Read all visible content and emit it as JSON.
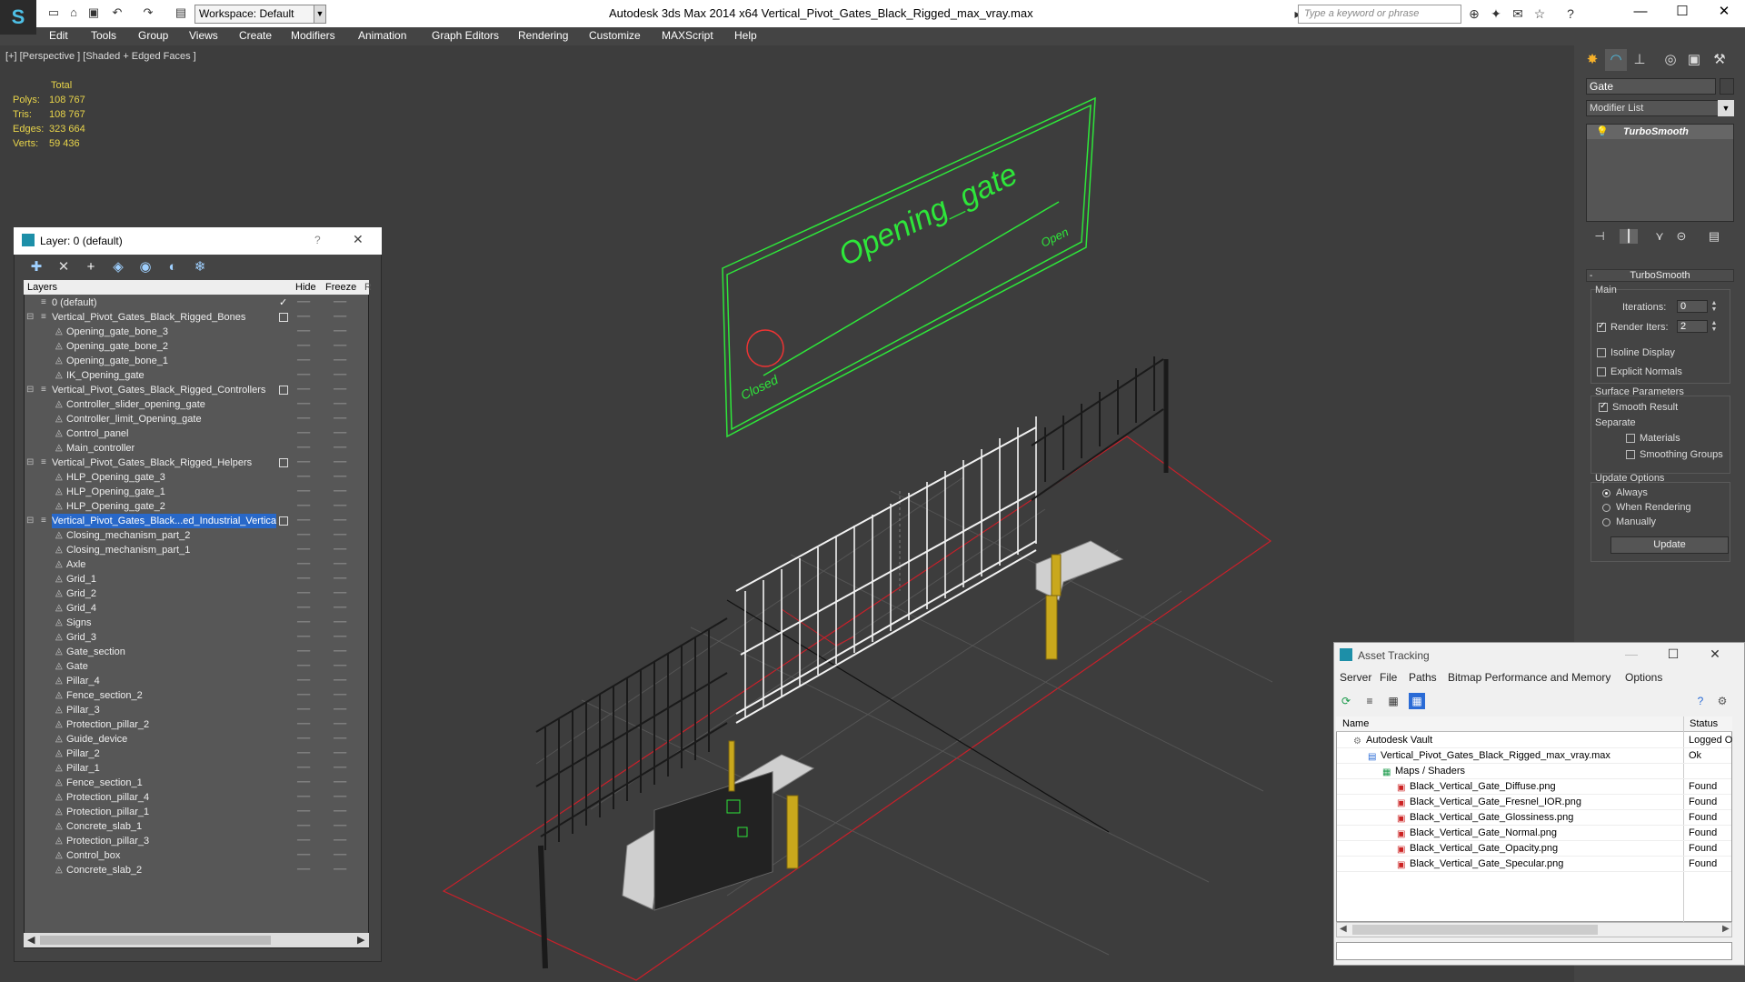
{
  "titlebar": {
    "workspace": "Workspace: Default",
    "title": "Autodesk 3ds Max  2014 x64        Vertical_Pivot_Gates_Black_Rigged_max_vray.max",
    "search_placeholder": "Type a keyword or phrase"
  },
  "menu": [
    "Edit",
    "Tools",
    "Group",
    "Views",
    "Create",
    "Modifiers",
    "Animation",
    "Graph Editors",
    "Rendering",
    "Customize",
    "MAXScript",
    "Help"
  ],
  "viewport": {
    "label": "[+] [Perspective ] [Shaded + Edged Faces ]",
    "stats_header": "Total",
    "stats": [
      {
        "label": "Polys:",
        "value": "108 767"
      },
      {
        "label": "Tris:",
        "value": "108 767"
      },
      {
        "label": "Edges:",
        "value": "323 664"
      },
      {
        "label": "Verts:",
        "value": "59 436"
      }
    ],
    "sign_title": "Opening_gate",
    "sign_open": "Open",
    "sign_closed": "Closed"
  },
  "layer_window": {
    "title": "Layer: 0 (default)",
    "help": "?",
    "col_layers": "Layers",
    "col_hide": "Hide",
    "col_freeze": "Freeze",
    "col_extra": "R",
    "rows": [
      {
        "name": "0 (default)",
        "level": 0,
        "type": "layer",
        "current": true
      },
      {
        "name": "Vertical_Pivot_Gates_Black_Rigged_Bones",
        "level": 0,
        "type": "layer"
      },
      {
        "name": "Opening_gate_bone_3",
        "level": 1,
        "type": "obj"
      },
      {
        "name": "Opening_gate_bone_2",
        "level": 1,
        "type": "obj"
      },
      {
        "name": "Opening_gate_bone_1",
        "level": 1,
        "type": "obj"
      },
      {
        "name": "IK_Opening_gate",
        "level": 1,
        "type": "obj"
      },
      {
        "name": "Vertical_Pivot_Gates_Black_Rigged_Controllers",
        "level": 0,
        "type": "layer"
      },
      {
        "name": "Controller_slider_opening_gate",
        "level": 1,
        "type": "obj"
      },
      {
        "name": "Controller_limit_Opening_gate",
        "level": 1,
        "type": "obj"
      },
      {
        "name": "Control_panel",
        "level": 1,
        "type": "obj"
      },
      {
        "name": "Main_controller",
        "level": 1,
        "type": "obj"
      },
      {
        "name": "Vertical_Pivot_Gates_Black_Rigged_Helpers",
        "level": 0,
        "type": "layer"
      },
      {
        "name": "HLP_Opening_gate_3",
        "level": 1,
        "type": "obj"
      },
      {
        "name": "HLP_Opening_gate_1",
        "level": 1,
        "type": "obj"
      },
      {
        "name": "HLP_Opening_gate_2",
        "level": 1,
        "type": "obj"
      },
      {
        "name": "Vertical_Pivot_Gates_Black...ed_Industrial_Vertica",
        "level": 0,
        "type": "layer",
        "selected": true
      },
      {
        "name": "Closing_mechanism_part_2",
        "level": 1,
        "type": "obj"
      },
      {
        "name": "Closing_mechanism_part_1",
        "level": 1,
        "type": "obj"
      },
      {
        "name": "Axle",
        "level": 1,
        "type": "obj"
      },
      {
        "name": "Grid_1",
        "level": 1,
        "type": "obj"
      },
      {
        "name": "Grid_2",
        "level": 1,
        "type": "obj"
      },
      {
        "name": "Grid_4",
        "level": 1,
        "type": "obj"
      },
      {
        "name": "Signs",
        "level": 1,
        "type": "obj"
      },
      {
        "name": "Grid_3",
        "level": 1,
        "type": "obj"
      },
      {
        "name": "Gate_section",
        "level": 1,
        "type": "obj"
      },
      {
        "name": "Gate",
        "level": 1,
        "type": "obj"
      },
      {
        "name": "Pillar_4",
        "level": 1,
        "type": "obj"
      },
      {
        "name": "Fence_section_2",
        "level": 1,
        "type": "obj"
      },
      {
        "name": "Pillar_3",
        "level": 1,
        "type": "obj"
      },
      {
        "name": "Protection_pillar_2",
        "level": 1,
        "type": "obj"
      },
      {
        "name": "Guide_device",
        "level": 1,
        "type": "obj"
      },
      {
        "name": "Pillar_2",
        "level": 1,
        "type": "obj"
      },
      {
        "name": "Pillar_1",
        "level": 1,
        "type": "obj"
      },
      {
        "name": "Fence_section_1",
        "level": 1,
        "type": "obj"
      },
      {
        "name": "Protection_pillar_4",
        "level": 1,
        "type": "obj"
      },
      {
        "name": "Protection_pillar_1",
        "level": 1,
        "type": "obj"
      },
      {
        "name": "Concrete_slab_1",
        "level": 1,
        "type": "obj"
      },
      {
        "name": "Protection_pillar_3",
        "level": 1,
        "type": "obj"
      },
      {
        "name": "Control_box",
        "level": 1,
        "type": "obj"
      },
      {
        "name": "Concrete_slab_2",
        "level": 1,
        "type": "obj"
      }
    ]
  },
  "command_panel": {
    "object_name": "Gate",
    "modifier_list": "Modifier List",
    "stack_item": "TurboSmooth",
    "rollout": "TurboSmooth",
    "main_group": "Main",
    "iterations_label": "Iterations:",
    "iterations_value": "0",
    "render_iters_label": "Render Iters:",
    "render_iters_value": "2",
    "isoline": "Isoline Display",
    "explicit_normals": "Explicit Normals",
    "surface_group": "Surface Parameters",
    "smooth_result": "Smooth Result",
    "separate": "Separate",
    "materials": "Materials",
    "smoothing_groups": "Smoothing Groups",
    "update_group": "Update Options",
    "always": "Always",
    "when_rendering": "When Rendering",
    "manually": "Manually",
    "update_button": "Update"
  },
  "asset_tracking": {
    "title": "Asset Tracking",
    "menu": [
      "Server",
      "File",
      "Paths",
      "Bitmap Performance and Memory",
      "Options"
    ],
    "col_name": "Name",
    "col_status": "Status",
    "rows": [
      {
        "name": "Autodesk Vault",
        "level": 0,
        "icon": "vault-icon",
        "status": "Logged O"
      },
      {
        "name": "Vertical_Pivot_Gates_Black_Rigged_max_vray.max",
        "level": 1,
        "icon": "max-file-icon",
        "status": "Ok"
      },
      {
        "name": "Maps / Shaders",
        "level": 2,
        "icon": "maps-icon",
        "status": ""
      },
      {
        "name": "Black_Vertical_Gate_Diffuse.png",
        "level": 3,
        "icon": "png-icon",
        "status": "Found"
      },
      {
        "name": "Black_Vertical_Gate_Fresnel_IOR.png",
        "level": 3,
        "icon": "png-icon",
        "status": "Found"
      },
      {
        "name": "Black_Vertical_Gate_Glossiness.png",
        "level": 3,
        "icon": "png-icon",
        "status": "Found"
      },
      {
        "name": "Black_Vertical_Gate_Normal.png",
        "level": 3,
        "icon": "png-icon",
        "status": "Found"
      },
      {
        "name": "Black_Vertical_Gate_Opacity.png",
        "level": 3,
        "icon": "png-icon",
        "status": "Found"
      },
      {
        "name": "Black_Vertical_Gate_Specular.png",
        "level": 3,
        "icon": "png-icon",
        "status": "Found"
      }
    ]
  },
  "colors": {
    "viewport_bg": "#3d3d3d",
    "selection_blue": "#2868c9",
    "stats_yellow": "#e8d44a",
    "wire_green": "#2ee63a",
    "grid_red": "#c8202a"
  }
}
